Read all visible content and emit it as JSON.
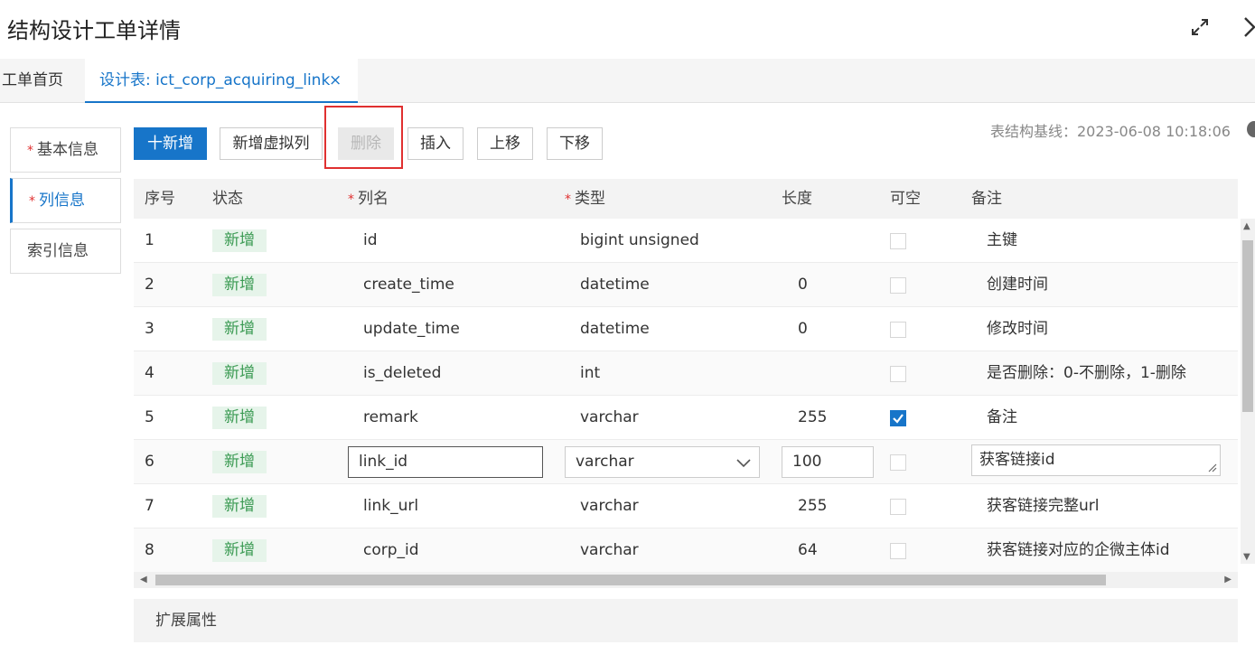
{
  "window": {
    "title": "结构设计工单详情"
  },
  "tabs": [
    {
      "label": "工单首页"
    },
    {
      "label": "设计表: ict_corp_acquiring_link",
      "close": "×"
    }
  ],
  "sidebar": {
    "items": [
      {
        "label": "基本信息",
        "required": "*"
      },
      {
        "label": "列信息",
        "required": "*"
      },
      {
        "label": "索引信息"
      }
    ]
  },
  "toolbar": {
    "add": "十新增",
    "add_virtual": "新增虚拟列",
    "delete": "删除",
    "insert": "插入",
    "move_up": "上移",
    "move_down": "下移"
  },
  "baseline": {
    "text": "表结构基线：2023-06-08 10:18:06"
  },
  "table": {
    "headers": {
      "index": "序号",
      "status": "状态",
      "name": "列名",
      "type": "类型",
      "length": "长度",
      "nullable": "可空",
      "comment": "备注",
      "required_mark": "*"
    },
    "rows": [
      {
        "index": "1",
        "status": "新增",
        "name": "id",
        "type": "bigint unsigned",
        "length": "",
        "nullable": false,
        "comment": "主键"
      },
      {
        "index": "2",
        "status": "新增",
        "name": "create_time",
        "type": "datetime",
        "length": "0",
        "nullable": false,
        "comment": "创建时间"
      },
      {
        "index": "3",
        "status": "新增",
        "name": "update_time",
        "type": "datetime",
        "length": "0",
        "nullable": false,
        "comment": "修改时间"
      },
      {
        "index": "4",
        "status": "新增",
        "name": "is_deleted",
        "type": "int",
        "length": "",
        "nullable": false,
        "comment": "是否删除：0-不删除，1-删除"
      },
      {
        "index": "5",
        "status": "新增",
        "name": "remark",
        "type": "varchar",
        "length": "255",
        "nullable": true,
        "comment": "备注"
      },
      {
        "index": "6",
        "status": "新增",
        "name": "link_id",
        "type": "varchar",
        "length": "100",
        "nullable": false,
        "comment": "获客链接id",
        "editing": true
      },
      {
        "index": "7",
        "status": "新增",
        "name": "link_url",
        "type": "varchar",
        "length": "255",
        "nullable": false,
        "comment": "获客链接完整url"
      },
      {
        "index": "8",
        "status": "新增",
        "name": "corp_id",
        "type": "varchar",
        "length": "64",
        "nullable": false,
        "comment": "获客链接对应的企微主体id"
      }
    ]
  },
  "extension": {
    "label": "扩展属性"
  },
  "colors": {
    "primary": "#1775c9",
    "badge_text": "#3a9a52",
    "badge_bg": "#e6f4ea",
    "highlight": "#e03030"
  }
}
